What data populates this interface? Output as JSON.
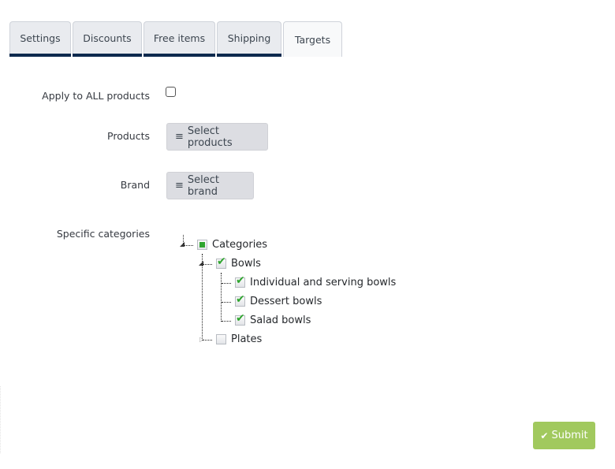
{
  "tabs": [
    {
      "label": "Settings",
      "active": false
    },
    {
      "label": "Discounts",
      "active": false
    },
    {
      "label": "Free items",
      "active": false
    },
    {
      "label": "Shipping",
      "active": false
    },
    {
      "label": "Targets",
      "active": true
    }
  ],
  "form": {
    "apply_all": {
      "label": "Apply to ALL products",
      "checked": false
    },
    "products": {
      "label": "Products",
      "button": "Select products",
      "icon": "list-icon"
    },
    "brand": {
      "label": "Brand",
      "button": "Select brand",
      "icon": "list-icon"
    },
    "categories": {
      "label": "Specific categories",
      "tree": {
        "label": "Categories",
        "state": "partial",
        "expanded": true,
        "children": [
          {
            "label": "Bowls",
            "state": "checked",
            "expanded": true,
            "children": [
              {
                "label": "Individual and serving bowls",
                "state": "checked"
              },
              {
                "label": "Dessert bowls",
                "state": "checked"
              },
              {
                "label": "Salad bowls",
                "state": "checked"
              }
            ]
          },
          {
            "label": "Plates",
            "state": "unchecked",
            "expanded": false
          }
        ]
      }
    }
  },
  "submit": {
    "label": "Submit",
    "icon": "check-icon",
    "color": "#a1c95e"
  },
  "colors": {
    "tab_underline": "#0e2a4e",
    "check_green": "#2fa52f"
  }
}
